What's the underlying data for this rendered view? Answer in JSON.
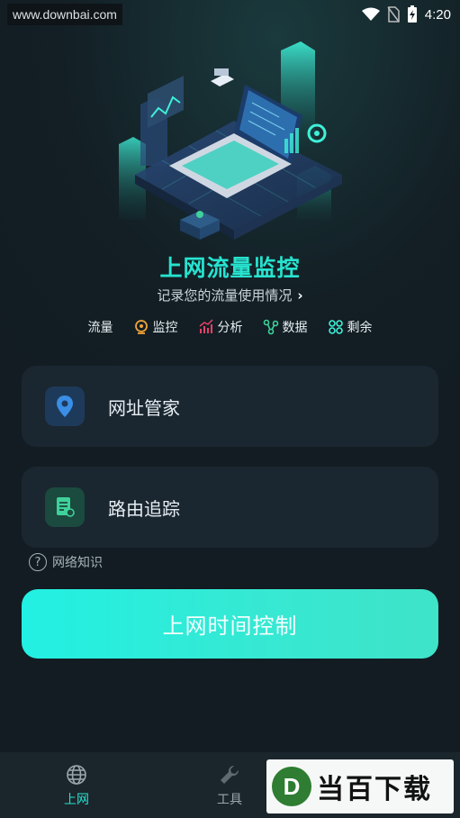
{
  "status_bar": {
    "watermark": "www.downbai.com",
    "time": "4:20"
  },
  "hero": {
    "title": "上网流量监控",
    "subtitle": "记录您的流量使用情况",
    "tags": [
      {
        "label": "流量",
        "icon": "none"
      },
      {
        "label": "监控",
        "icon": "webcam-icon"
      },
      {
        "label": "分析",
        "icon": "chart-icon"
      },
      {
        "label": "数据",
        "icon": "nodes-icon"
      },
      {
        "label": "剩余",
        "icon": "grid-icon"
      }
    ]
  },
  "cards": [
    {
      "label": "网址管家",
      "icon": "location-pin-icon",
      "icon_bg": "#1e3a5a",
      "icon_color": "#3a8ee6"
    },
    {
      "label": "路由追踪",
      "icon": "document-icon",
      "icon_bg": "#1b4a3e",
      "icon_color": "#3fd19a"
    }
  ],
  "help_label": "网络知识",
  "primary_button": "上网时间控制",
  "bottom_nav": [
    {
      "label": "上网",
      "icon": "globe-icon",
      "active": true
    },
    {
      "label": "工具",
      "icon": "wrench-icon",
      "active": false
    }
  ],
  "brand": {
    "letter": "D",
    "text": "当百下载"
  },
  "colors": {
    "accent": "#27e3cf",
    "background": "#121c22",
    "card": "#1a2630"
  }
}
